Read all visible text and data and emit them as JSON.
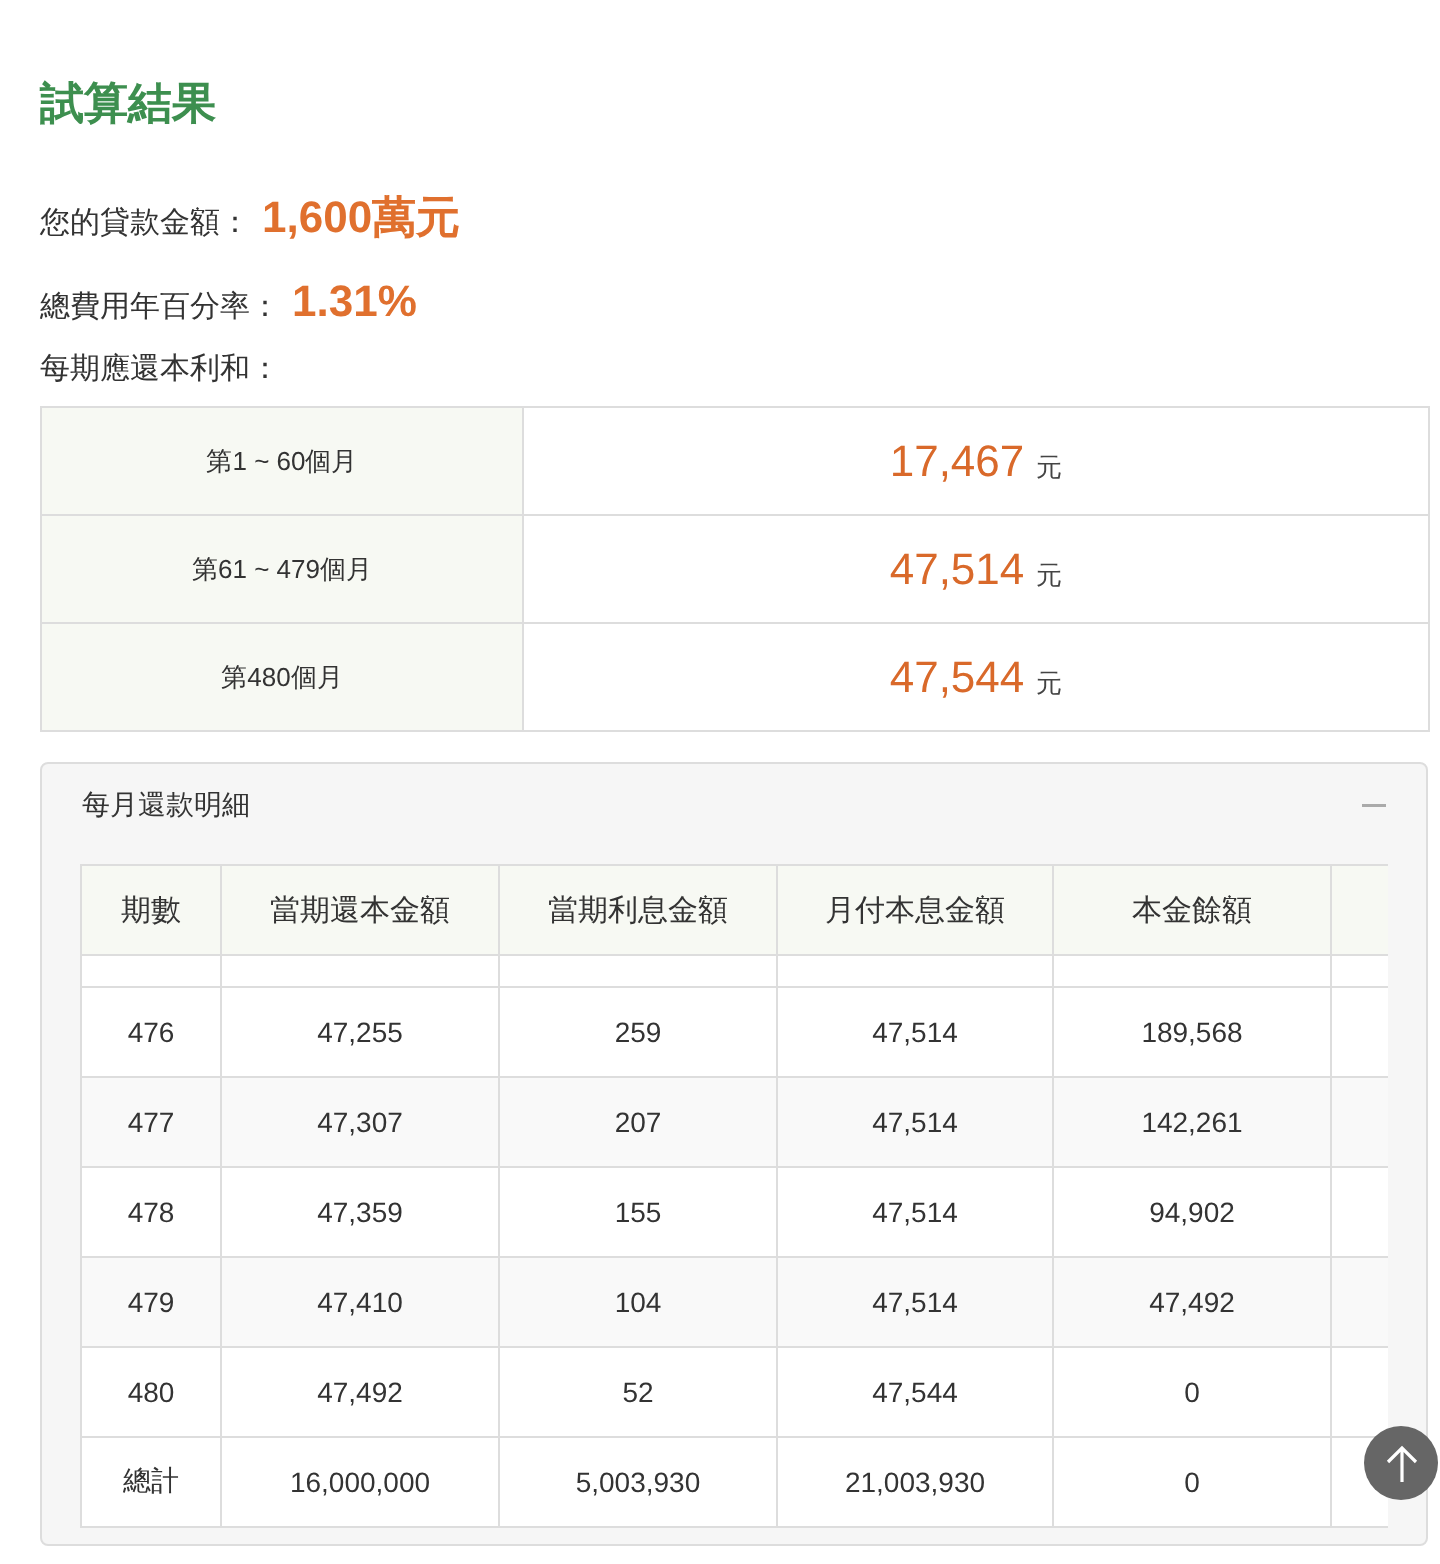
{
  "title": "試算結果",
  "summary": [
    {
      "label": "您的貸款金額：",
      "value": "1,600萬元"
    },
    {
      "label": "總費用年百分率：",
      "value": "1.31%"
    }
  ],
  "installments_label": "每期應還本利和：",
  "installments": [
    {
      "period": "第1 ~ 60個月",
      "amount": "17,467",
      "unit": "元"
    },
    {
      "period": "第61 ~ 479個月",
      "amount": "47,514",
      "unit": "元"
    },
    {
      "period": "第480個月",
      "amount": "47,544",
      "unit": "元"
    }
  ],
  "detail": {
    "title": "每月還款明細",
    "expanded": true,
    "columns": [
      "期數",
      "當期還本金額",
      "當期利息金額",
      "月付本息金額",
      "本金餘額"
    ],
    "rows": [
      [
        "476",
        "47,255",
        "259",
        "47,514",
        "189,568"
      ],
      [
        "477",
        "47,307",
        "207",
        "47,514",
        "142,261"
      ],
      [
        "478",
        "47,359",
        "155",
        "47,514",
        "94,902"
      ],
      [
        "479",
        "47,410",
        "104",
        "47,514",
        "47,492"
      ],
      [
        "480",
        "47,492",
        "52",
        "47,544",
        "0"
      ],
      [
        "總計",
        "16,000,000",
        "5,003,930",
        "21,003,930",
        "0"
      ]
    ]
  }
}
